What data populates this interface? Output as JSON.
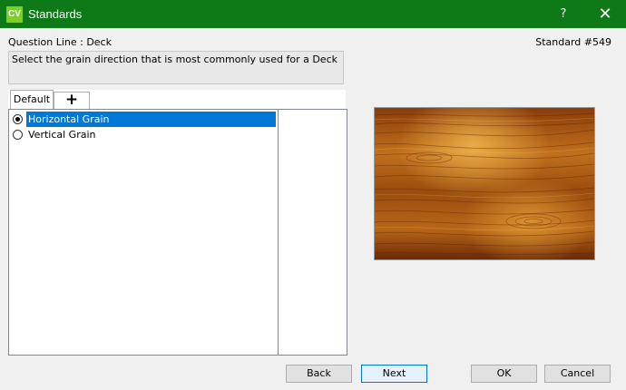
{
  "window": {
    "title": "Standards",
    "app_icon_text": "CV",
    "help_symbol": "?",
    "close_symbol": "✕"
  },
  "header": {
    "question_line": "Question Line : Deck",
    "standard_id": "Standard #549"
  },
  "question": {
    "text": "Select the grain direction that is most commonly used for a Deck"
  },
  "tabs": [
    {
      "label": "Default",
      "selected": true
    },
    {
      "label": "+",
      "selected": false
    }
  ],
  "options": [
    {
      "label": "Horizontal Grain",
      "checked": true
    },
    {
      "label": "Vertical Grain",
      "checked": false
    }
  ],
  "buttons": {
    "back": "Back",
    "next": "Next",
    "ok": "OK",
    "cancel": "Cancel"
  },
  "colors": {
    "titlebar": "#0d7a17",
    "selection": "#0078d7",
    "wood_dark": "#6b2a06",
    "wood_light": "#e3a032"
  }
}
